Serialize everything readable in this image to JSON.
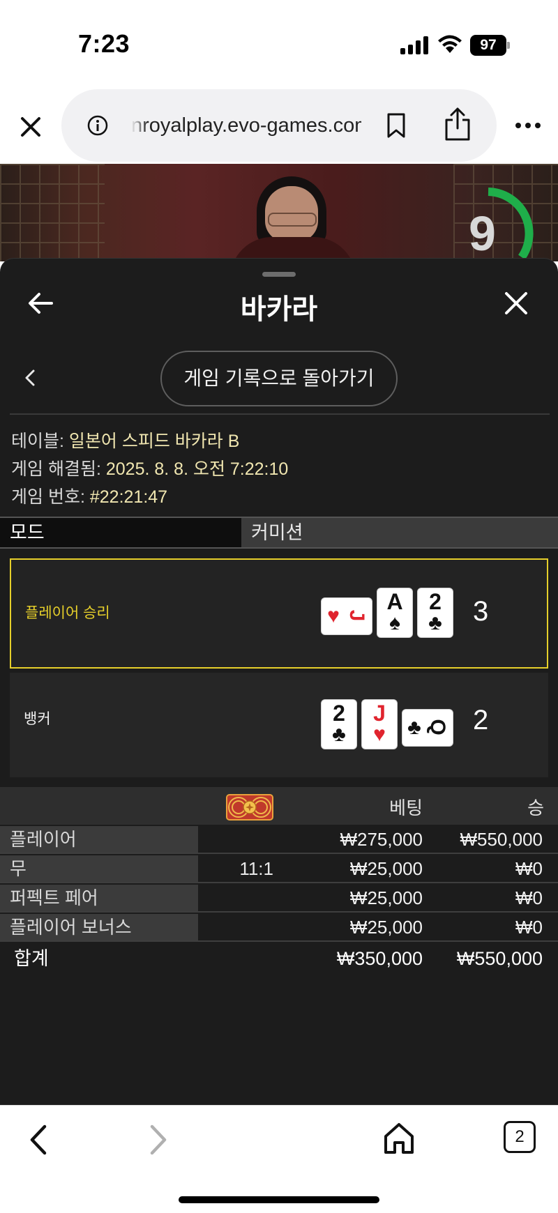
{
  "status_bar": {
    "time": "7:23",
    "battery": "97"
  },
  "browser": {
    "url": "nroyalplay.evo-games.com"
  },
  "video": {
    "timer": "9"
  },
  "panel": {
    "title": "바카라",
    "history_button": "게임 기록으로 돌아가기",
    "info": {
      "table_label": "테이블:",
      "table_value": "일본어 스피드 바카라 B",
      "resolved_label": "게임 해결됨:",
      "resolved_value": "2025. 8. 8. 오전 7:22:10",
      "number_label": "게임 번호:",
      "number_value": "#22:21:47"
    },
    "mode_label": "모드",
    "commission_label": "커미션"
  },
  "results": {
    "player": {
      "label": "플레이어 승리",
      "total": "3",
      "cards": [
        {
          "rank": "J",
          "suit": "♥",
          "color": "red",
          "sideways": true
        },
        {
          "rank": "A",
          "suit": "♠",
          "color": "black",
          "sideways": false
        },
        {
          "rank": "2",
          "suit": "♣",
          "color": "black",
          "sideways": false
        }
      ]
    },
    "banker": {
      "label": "뱅커",
      "total": "2",
      "cards": [
        {
          "rank": "2",
          "suit": "♣",
          "color": "black",
          "sideways": false
        },
        {
          "rank": "J",
          "suit": "♥",
          "color": "red",
          "sideways": false
        },
        {
          "rank": "Q",
          "suit": "♣",
          "color": "black",
          "sideways": true
        }
      ]
    }
  },
  "bets": {
    "col_bet": "베팅",
    "col_win": "승",
    "rows": [
      {
        "name": "플레이어",
        "odds": "",
        "bet": "₩275,000",
        "win": "₩550,000"
      },
      {
        "name": "무",
        "odds": "11:1",
        "bet": "₩25,000",
        "win": "₩0"
      },
      {
        "name": "퍼펙트 페어",
        "odds": "",
        "bet": "₩25,000",
        "win": "₩0"
      },
      {
        "name": "플레이어 보너스",
        "odds": "",
        "bet": "₩25,000",
        "win": "₩0"
      }
    ],
    "total_label": "합계",
    "total_bet": "₩350,000",
    "total_win": "₩550,000"
  },
  "bottom_bar": {
    "tab_count": "2"
  },
  "colors": {
    "accent_yellow": "#e6cf2a",
    "panel_bg": "#1c1c1c",
    "timer_green": "#1fae4a"
  },
  "icons": [
    "signal-icon",
    "wifi-icon",
    "battery-icon",
    "close-icon",
    "info-icon",
    "bookmark-icon",
    "share-icon",
    "more-icon",
    "arrow-left-icon",
    "chevron-left-icon",
    "chip-icon",
    "home-icon",
    "tabs-icon"
  ]
}
